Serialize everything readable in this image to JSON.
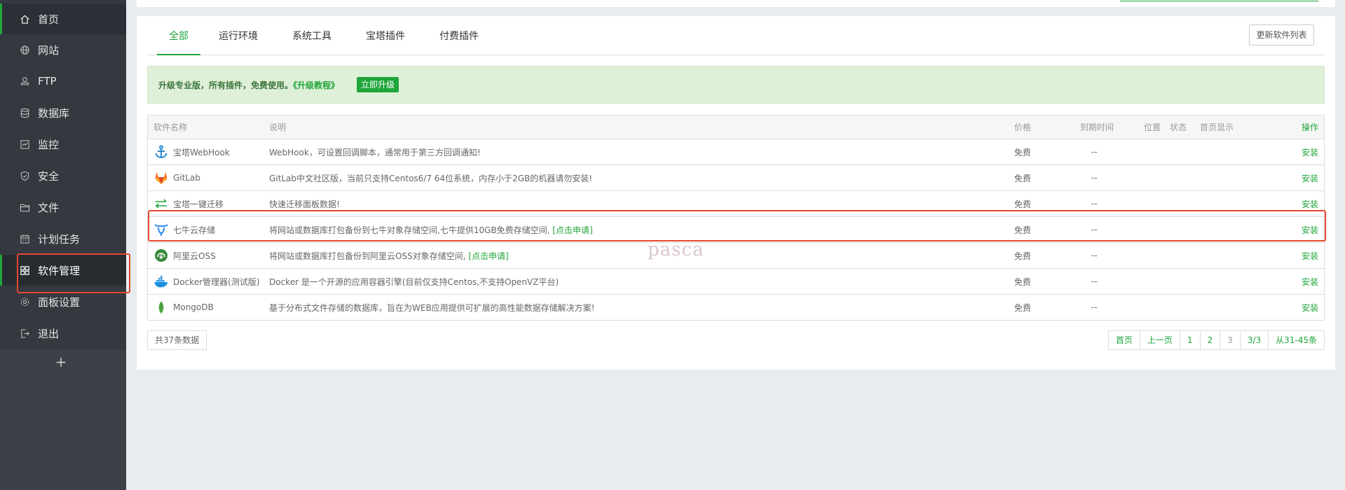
{
  "sidebar": {
    "items": [
      {
        "label": "首页",
        "icon": "home-icon"
      },
      {
        "label": "网站",
        "icon": "globe-icon"
      },
      {
        "label": "FTP",
        "icon": "ftp-icon"
      },
      {
        "label": "数据库",
        "icon": "database-icon"
      },
      {
        "label": "监控",
        "icon": "monitor-icon"
      },
      {
        "label": "安全",
        "icon": "shield-icon"
      },
      {
        "label": "文件",
        "icon": "folder-icon"
      },
      {
        "label": "计划任务",
        "icon": "calendar-icon"
      },
      {
        "label": "软件管理",
        "icon": "grid-icon"
      },
      {
        "label": "面板设置",
        "icon": "gear-icon"
      },
      {
        "label": "退出",
        "icon": "logout-icon"
      }
    ],
    "add_label": "+"
  },
  "tabs": [
    "全部",
    "运行环境",
    "系统工具",
    "宝塔插件",
    "付费插件"
  ],
  "refresh_button": "更新软件列表",
  "notice": {
    "text": "升级专业版，所有插件，免费使用。",
    "link": "《升级教程》",
    "button": "立即升级"
  },
  "table": {
    "headers": {
      "name": "软件名称",
      "desc": "说明",
      "price": "价格",
      "expire": "到期时间",
      "position": "位置",
      "status": "状态",
      "home": "首页显示",
      "op": "操作"
    },
    "rows": [
      {
        "icon": "anchor-icon",
        "name": "宝塔WebHook",
        "desc": "WebHook，可设置回调脚本，通常用于第三方回调通知!",
        "link": "",
        "price": "免费",
        "expire": "--",
        "op": "安装"
      },
      {
        "icon": "gitlab-icon",
        "name": "GitLab",
        "desc": "GitLab中文社区版，当前只支持Centos6/7 64位系统，内存小于2GB的机器请勿安装!",
        "link": "",
        "price": "免费",
        "expire": "--",
        "op": "安装"
      },
      {
        "icon": "migrate-icon",
        "name": "宝塔一键迁移",
        "desc": "快速迁移面板数据!",
        "link": "",
        "price": "免费",
        "expire": "--",
        "op": "安装"
      },
      {
        "icon": "qiniu-icon",
        "name": "七牛云存储",
        "desc": "将网站或数据库打包备份到七牛对象存储空间,七牛提供10GB免费存储空间,",
        "link": "[点击申请]",
        "price": "免费",
        "expire": "--",
        "op": "安装"
      },
      {
        "icon": "aliyun-oss-icon",
        "name": "阿里云OSS",
        "desc": "将网站或数据库打包备份到阿里云OSS对象存储空间,",
        "link": "[点击申请]",
        "price": "免费",
        "expire": "--",
        "op": "安装"
      },
      {
        "icon": "docker-icon",
        "name": "Docker管理器(测试版)",
        "desc": "Docker 是一个开源的应用容器引擎(目前仅支持Centos,不支持OpenVZ平台)",
        "link": "",
        "price": "免费",
        "expire": "--",
        "op": "安装"
      },
      {
        "icon": "mongodb-icon",
        "name": "MongoDB",
        "desc": "基于分布式文件存储的数据库，旨在为WEB应用提供可扩展的高性能数据存储解决方案!",
        "link": "",
        "price": "免费",
        "expire": "--",
        "op": "安装"
      }
    ]
  },
  "footer": {
    "count": "共37条数据",
    "pager": [
      "首页",
      "上一页",
      "1",
      "2",
      "3",
      "3/3",
      "从31-45条"
    ]
  },
  "watermark": "pasca",
  "colors": {
    "accent": "#20a53a",
    "sidebar": "#33393f",
    "highlight": "#e3492f"
  }
}
